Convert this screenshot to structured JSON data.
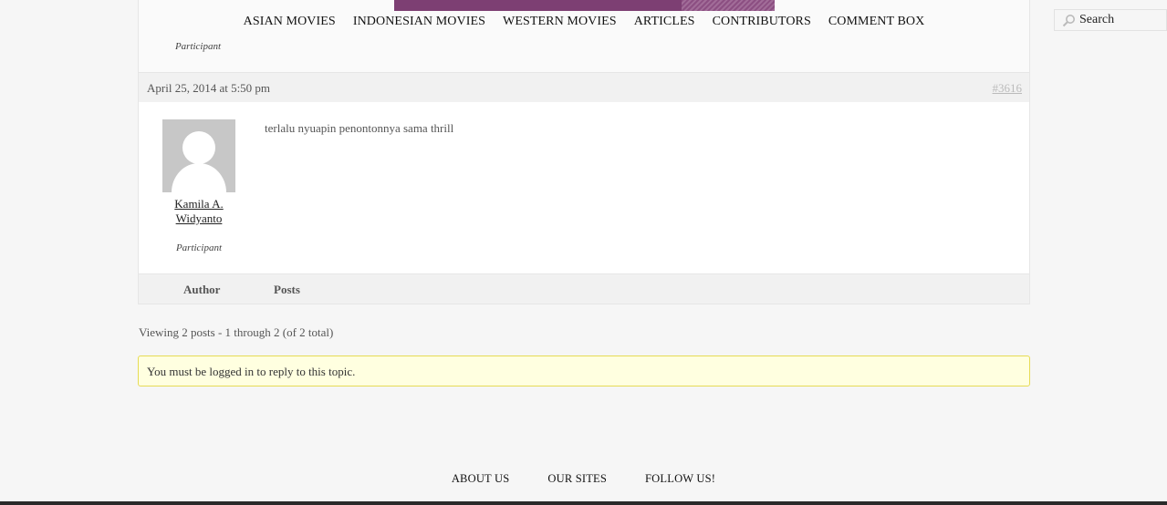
{
  "nav": {
    "items": [
      "ASIAN MOVIES",
      "INDONESIAN MOVIES",
      "WESTERN MOVIES",
      "ARTICLES",
      "CONTRIBUTORS",
      "COMMENT BOX"
    ]
  },
  "search": {
    "placeholder": "Search"
  },
  "previous_reply": {
    "role": "Participant"
  },
  "reply": {
    "date": "April 25, 2014 at 5:50 pm",
    "permalink": "#3616",
    "author_first": "Kamila A.",
    "author_last": "Widyanto",
    "role": "Participant",
    "content": "terlalu nyuapin penontonnya sama thrill"
  },
  "table_footer": {
    "author": "Author",
    "posts": "Posts"
  },
  "pagination": {
    "count": "Viewing 2 posts - 1 through 2 (of 2 total)"
  },
  "notice": {
    "text": "You must be logged in to reply to this topic."
  },
  "footer": {
    "items": [
      "ABOUT US",
      "OUR SITES",
      "FOLLOW US!"
    ]
  },
  "colors": {
    "brand": "#7d3f73",
    "notice_bg": "#ffffe0",
    "notice_border": "#e6db55"
  },
  "icons": {
    "search": "search-icon",
    "avatar": "default-avatar-icon"
  }
}
